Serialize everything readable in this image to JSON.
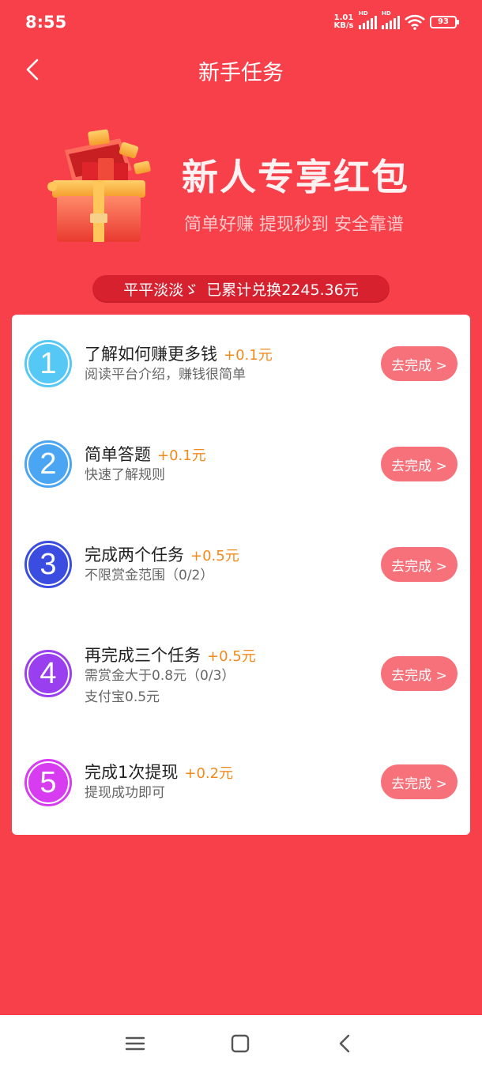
{
  "status": {
    "time": "8:55",
    "net_speed_value": "1.01",
    "net_speed_unit": "KB/s",
    "battery": "93",
    "sig1": "HD",
    "sig2": "HD"
  },
  "nav": {
    "title": "新手任务"
  },
  "banner": {
    "title": "新人专享红包",
    "subtitle": "简单好赚 提现秒到 安全靠谱"
  },
  "ticker": {
    "user": "平平淡淡ゞ",
    "text": "已累计兑换2245.36元"
  },
  "tasks": [
    {
      "num": "1",
      "title": "了解如何赚更多钱",
      "reward": "+0.1元",
      "desc": [
        "阅读平台介绍，赚钱很简单"
      ],
      "button": "去完成 >",
      "color": "#56c8f5"
    },
    {
      "num": "2",
      "title": "简单答题",
      "reward": "+0.1元",
      "desc": [
        "快速了解规则"
      ],
      "button": "去完成 >",
      "color": "#4aa5f2"
    },
    {
      "num": "3",
      "title": "完成两个任务",
      "reward": "+0.5元",
      "desc": [
        "不限赏金范围（0/2）"
      ],
      "button": "去完成 >",
      "color": "#3b4de0"
    },
    {
      "num": "4",
      "title": "再完成三个任务",
      "reward": "+0.5元",
      "desc": [
        "需赏金大于0.8元（0/3）",
        "支付宝0.5元"
      ],
      "button": "去完成 >",
      "color": "#9a3ff0"
    },
    {
      "num": "5",
      "title": "完成1次提现",
      "reward": "+0.2元",
      "desc": [
        "提现成功即可"
      ],
      "button": "去完成 >",
      "color": "#d83cf0"
    }
  ],
  "colors": {
    "background": "#f8404a",
    "button": "#f7717b",
    "reward": "#f28a1b",
    "ticker": "#d8212f"
  },
  "icons": {
    "back": "chevron-left-icon",
    "menu": "menu-icon",
    "home": "home-square-icon",
    "nav_back": "nav-back-icon",
    "gift": "gift-box-icon",
    "wifi": "wifi-icon",
    "signal": "signal-icon",
    "battery": "battery-icon"
  }
}
